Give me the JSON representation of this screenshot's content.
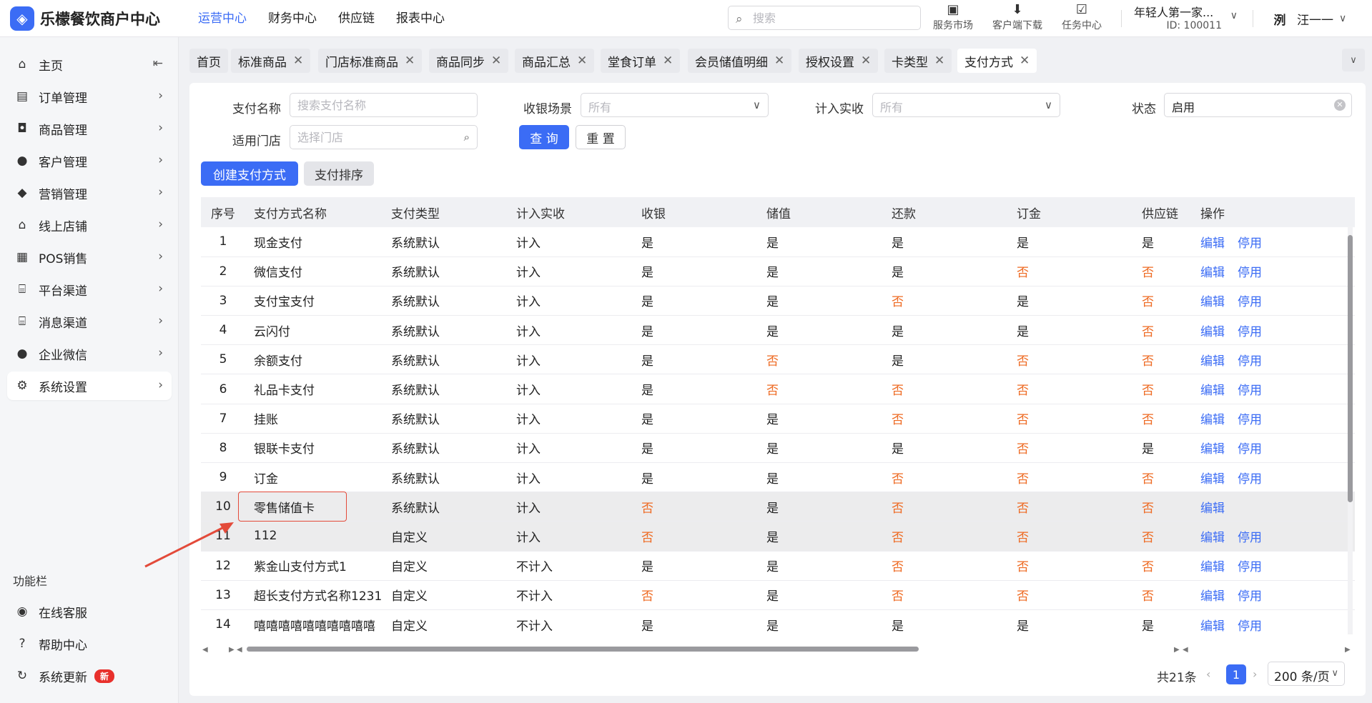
{
  "app": {
    "name": "乐檬餐饮商户中心",
    "logo_glyph": "◈"
  },
  "topnav": [
    {
      "label": "运营中心",
      "active": true
    },
    {
      "label": "财务中心"
    },
    {
      "label": "供应链"
    },
    {
      "label": "报表中心"
    }
  ],
  "search": {
    "placeholder": "搜索",
    "icon": "search-icon"
  },
  "tools": [
    {
      "label": "服务市场",
      "icon": "briefcase-icon"
    },
    {
      "label": "客户端下载",
      "icon": "download-folder-icon"
    },
    {
      "label": "任务中心",
      "icon": "clipboard-icon"
    }
  ],
  "shop": {
    "name": "年轻人第一家...",
    "id": "ID: 100011"
  },
  "user": {
    "avatar_text": "洌",
    "name": "汪一一"
  },
  "sidebar": {
    "collapse_icon": "⇤",
    "items": [
      {
        "label": "主页",
        "icon": "home-icon"
      },
      {
        "label": "订单管理",
        "icon": "order-icon"
      },
      {
        "label": "商品管理",
        "icon": "bag-icon"
      },
      {
        "label": "客户管理",
        "icon": "user-icon"
      },
      {
        "label": "营销管理",
        "icon": "tag-icon"
      },
      {
        "label": "线上店铺",
        "icon": "store-icon"
      },
      {
        "label": "POS销售",
        "icon": "pos-icon"
      },
      {
        "label": "平台渠道",
        "icon": "bank-icon"
      },
      {
        "label": "消息渠道",
        "icon": "message-icon"
      },
      {
        "label": "企业微信",
        "icon": "wechat-icon"
      },
      {
        "label": "系统设置",
        "icon": "gear-icon",
        "active": true
      }
    ],
    "section_title": "功能栏",
    "footer": [
      {
        "label": "在线客服",
        "icon": "headset-icon"
      },
      {
        "label": "帮助中心",
        "icon": "help-icon"
      },
      {
        "label": "系统更新",
        "icon": "refresh-icon",
        "badge": "新"
      }
    ]
  },
  "tabs": [
    {
      "label": "首页",
      "closable": false
    },
    {
      "label": "标准商品",
      "closable": true
    },
    {
      "label": "门店标准商品",
      "closable": true
    },
    {
      "label": "商品同步",
      "closable": true
    },
    {
      "label": "商品汇总",
      "closable": true
    },
    {
      "label": "堂食订单",
      "closable": true
    },
    {
      "label": "会员储值明细",
      "closable": true
    },
    {
      "label": "授权设置",
      "closable": true
    },
    {
      "label": "卡类型",
      "closable": true
    },
    {
      "label": "支付方式",
      "closable": true,
      "active": true
    }
  ],
  "filters": {
    "pay_name": {
      "label": "支付名称",
      "placeholder": "搜索支付名称"
    },
    "scene": {
      "label": "收银场景",
      "placeholder": "所有"
    },
    "count_actual": {
      "label": "计入实收",
      "placeholder": "所有"
    },
    "status": {
      "label": "状态",
      "value": "启用"
    },
    "store": {
      "label": "适用门店",
      "placeholder": "选择门店"
    },
    "query_btn": "查 询",
    "reset_btn": "重 置"
  },
  "actions": {
    "create": "创建支付方式",
    "sort": "支付排序"
  },
  "table": {
    "columns": [
      "序号",
      "支付方式名称",
      "支付类型",
      "计入实收",
      "收银",
      "储值",
      "还款",
      "订金",
      "供应链",
      "操作"
    ],
    "edit_label": "编辑",
    "disable_label": "停用",
    "rows": [
      {
        "no": "1",
        "name": "现金支付",
        "type": "系统默认",
        "actual": "计入",
        "cash": "是",
        "stored": "是",
        "repay": "是",
        "deposit": "是",
        "supply": "是",
        "disable": true
      },
      {
        "no": "2",
        "name": "微信支付",
        "type": "系统默认",
        "actual": "计入",
        "cash": "是",
        "stored": "是",
        "repay": "是",
        "deposit": "否",
        "supply": "否",
        "disable": true
      },
      {
        "no": "3",
        "name": "支付宝支付",
        "type": "系统默认",
        "actual": "计入",
        "cash": "是",
        "stored": "是",
        "repay": "否",
        "deposit": "是",
        "supply": "否",
        "disable": true
      },
      {
        "no": "4",
        "name": "云闪付",
        "type": "系统默认",
        "actual": "计入",
        "cash": "是",
        "stored": "是",
        "repay": "是",
        "deposit": "是",
        "supply": "否",
        "disable": true
      },
      {
        "no": "5",
        "name": "余额支付",
        "type": "系统默认",
        "actual": "计入",
        "cash": "是",
        "stored": "否",
        "repay": "是",
        "deposit": "否",
        "supply": "否",
        "disable": true
      },
      {
        "no": "6",
        "name": "礼品卡支付",
        "type": "系统默认",
        "actual": "计入",
        "cash": "是",
        "stored": "否",
        "repay": "否",
        "deposit": "否",
        "supply": "否",
        "disable": true
      },
      {
        "no": "7",
        "name": "挂账",
        "type": "系统默认",
        "actual": "计入",
        "cash": "是",
        "stored": "是",
        "repay": "否",
        "deposit": "否",
        "supply": "否",
        "disable": true
      },
      {
        "no": "8",
        "name": "银联卡支付",
        "type": "系统默认",
        "actual": "计入",
        "cash": "是",
        "stored": "是",
        "repay": "是",
        "deposit": "否",
        "supply": "是",
        "disable": true
      },
      {
        "no": "9",
        "name": "订金",
        "type": "系统默认",
        "actual": "计入",
        "cash": "是",
        "stored": "是",
        "repay": "否",
        "deposit": "否",
        "supply": "否",
        "disable": true
      },
      {
        "no": "10",
        "name": "零售储值卡",
        "type": "系统默认",
        "actual": "计入",
        "cash": "否",
        "stored": "是",
        "repay": "否",
        "deposit": "否",
        "supply": "否",
        "disable": false,
        "highlight": true
      },
      {
        "no": "11",
        "name": "112",
        "type": "自定义",
        "actual": "计入",
        "cash": "否",
        "stored": "是",
        "repay": "否",
        "deposit": "否",
        "supply": "否",
        "disable": true,
        "highlight": true
      },
      {
        "no": "12",
        "name": "紫金山支付方式1",
        "type": "自定义",
        "actual": "不计入",
        "cash": "是",
        "stored": "是",
        "repay": "否",
        "deposit": "否",
        "supply": "否",
        "disable": true
      },
      {
        "no": "13",
        "name": "超长支付方式名称1231",
        "type": "自定义",
        "actual": "不计入",
        "cash": "否",
        "stored": "是",
        "repay": "否",
        "deposit": "否",
        "supply": "否",
        "disable": true
      },
      {
        "no": "14",
        "name": "嘻嘻嘻嘻嘻嘻嘻嘻嘻嘻",
        "type": "自定义",
        "actual": "不计入",
        "cash": "是",
        "stored": "是",
        "repay": "是",
        "deposit": "是",
        "supply": "是",
        "disable": true
      }
    ]
  },
  "pagination": {
    "total": "共21条",
    "current": "1",
    "page_size": "200 条/页"
  },
  "colors": {
    "accent": "#3b6cf5",
    "negative": "#ee6a22",
    "annotation": "#e34a3a",
    "new_badge": "#e8302c"
  }
}
